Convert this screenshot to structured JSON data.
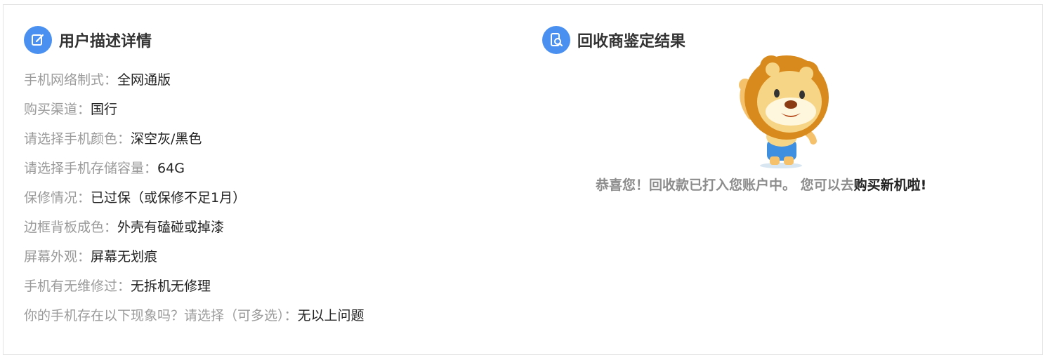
{
  "user_section": {
    "title": "用户描述详情",
    "icon": "edit-icon",
    "rows": [
      {
        "label": "手机网络制式：",
        "value": "全网通版"
      },
      {
        "label": "购买渠道：",
        "value": "国行"
      },
      {
        "label": "请选择手机颜色：",
        "value": "深空灰/黑色"
      },
      {
        "label": "请选择手机存储容量：",
        "value": "64G"
      },
      {
        "label": "保修情况：",
        "value": "已过保（或保修不足1月）"
      },
      {
        "label": "边框背板成色：",
        "value": "外壳有磕碰或掉漆"
      },
      {
        "label": "屏幕外观：",
        "value": "屏幕无划痕"
      },
      {
        "label": "手机有无维修过：",
        "value": "无拆机无修理"
      },
      {
        "label": "你的手机存在以下现象吗？请选择（可多选）：",
        "value": "无以上问题"
      }
    ]
  },
  "result_section": {
    "title": "回收商鉴定结果",
    "icon": "phone-inspect-icon",
    "mascot": "lion-mascot-icon",
    "message_prefix": "恭喜您！回收款已打入您账户中。 您可以去",
    "message_link": "购买新机啦!"
  },
  "colors": {
    "accent": "#4a90f0",
    "label": "#9a9a9a",
    "value": "#222222",
    "title": "#333333"
  }
}
